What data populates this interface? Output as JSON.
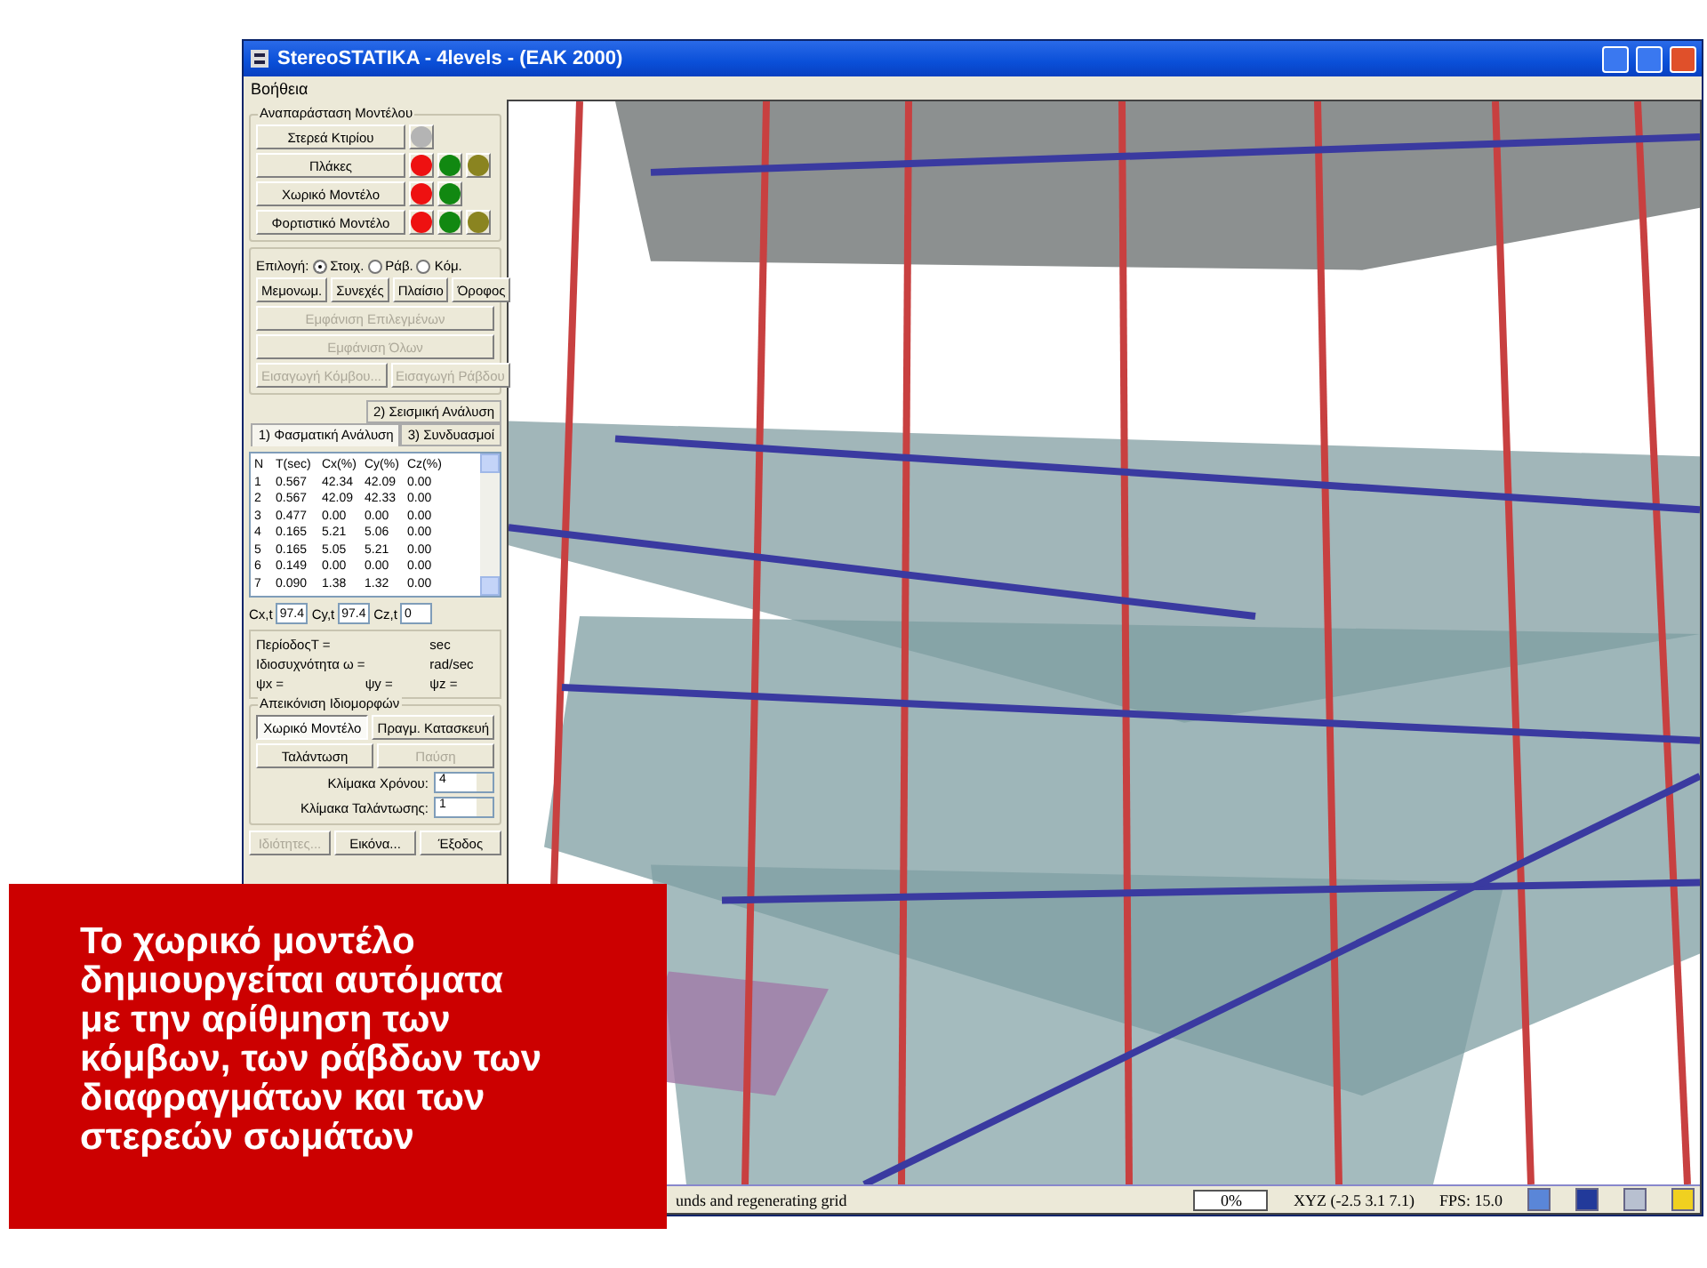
{
  "window": {
    "title": "StereoSTATIKA - 4levels - (EAK 2000)"
  },
  "menu": [
    "Βοήθεια"
  ],
  "model_group": {
    "title": "Αναπαράσταση Μοντέλου",
    "rows": [
      {
        "label": "Στερεά Κτιρίου",
        "lights": [
          {
            "color": "#b4b4b4"
          }
        ]
      },
      {
        "label": "Πλάκες",
        "lights": [
          {
            "color": "#ee1111"
          },
          {
            "color": "#118811"
          },
          {
            "color": "#8a8420"
          }
        ]
      },
      {
        "label": "Χωρικό Μοντέλο",
        "lights": [
          {
            "color": "#ee1111"
          },
          {
            "color": "#118811"
          }
        ]
      },
      {
        "label": "Φορτιστικό Μοντέλο",
        "lights": [
          {
            "color": "#ee1111"
          },
          {
            "color": "#118811"
          },
          {
            "color": "#8a8420"
          }
        ]
      }
    ]
  },
  "selection": {
    "label": "Επιλογή:",
    "radios": [
      {
        "label": "Στοιχ.",
        "selected": true
      },
      {
        "label": "Ράβ.",
        "selected": false
      },
      {
        "label": "Κόμ.",
        "selected": false
      }
    ],
    "buttons": [
      {
        "label": "Μεμονωμ.",
        "disabled": false
      },
      {
        "label": "Συνεχές",
        "disabled": false
      },
      {
        "label": "Πλαίσιο",
        "disabled": false
      },
      {
        "label": "Όροφος",
        "disabled": false
      }
    ],
    "wide_buttons": [
      {
        "label": "Εμφάνιση Επιλεγμένων",
        "disabled": true
      },
      {
        "label": "Εμφάνιση Όλων",
        "disabled": true
      }
    ],
    "insert_buttons": [
      {
        "label": "Εισαγωγή Κόμβου...",
        "disabled": true
      },
      {
        "label": "Εισαγωγή Ράβδου",
        "disabled": true
      }
    ]
  },
  "tabs": [
    {
      "label": "2) Σεισμική Ανάλυση",
      "selected": false
    },
    {
      "label": "1) Φασματική Ανάλυση",
      "selected": true
    },
    {
      "label": "3) Συνδυασμοί",
      "selected": false
    }
  ],
  "table": {
    "columns": [
      "N",
      "T(sec)",
      "Cx(%)",
      "Cy(%)",
      "Cz(%)"
    ],
    "rows": [
      [
        "1",
        "0.567",
        "42.34",
        "42.09",
        "0.00"
      ],
      [
        "2",
        "0.567",
        "42.09",
        "42.33",
        "0.00"
      ],
      [
        "3",
        "0.477",
        "0.00",
        "0.00",
        "0.00"
      ],
      [
        "4",
        "0.165",
        "5.21",
        "5.06",
        "0.00"
      ],
      [
        "5",
        "0.165",
        "5.05",
        "5.21",
        "0.00"
      ],
      [
        "6",
        "0.149",
        "0.00",
        "0.00",
        "0.00"
      ],
      [
        "7",
        "0.090",
        "1.38",
        "1.32",
        "0.00"
      ]
    ]
  },
  "totals": [
    {
      "label": "Cx,t",
      "value": "97.4"
    },
    {
      "label": "Cy,t",
      "value": "97.4"
    },
    {
      "label": "Cz,t",
      "value": "0"
    }
  ],
  "info": {
    "period": "ΠερίοδοςT =",
    "period_unit": "sec",
    "frequency": "Ιδιοσυχνότητα ω =",
    "frequency_unit": "rad/sec",
    "psi": [
      "ψx =",
      "ψy =",
      "ψz ="
    ]
  },
  "modes": {
    "title": "Απεικόνιση Ιδιομορφών",
    "buttons": [
      {
        "label": "Χωρικό Μοντέλο",
        "pressed": true,
        "disabled": false
      },
      {
        "label": "Πραγμ. Κατασκευή",
        "pressed": false,
        "disabled": false
      },
      {
        "label": "Ταλάντωση",
        "pressed": false,
        "disabled": false
      },
      {
        "label": "Παύση",
        "pressed": false,
        "disabled": true
      }
    ],
    "spinners": [
      {
        "label": "Κλίμακα Χρόνου:",
        "value": "4"
      },
      {
        "label": "Κλίμακα Ταλάντωσης:",
        "value": "1"
      }
    ]
  },
  "bottom_buttons": [
    {
      "label": "Ιδιότητες...",
      "disabled": true
    },
    {
      "label": "Εικόνα...",
      "disabled": false
    },
    {
      "label": "Έξοδος",
      "disabled": false
    }
  ],
  "status_bar": {
    "message": "unds and regenerating grid",
    "progress": "0%",
    "coords": "XYZ (-2.5  3.1  7.1)",
    "fps": "FPS: 15.0"
  },
  "caption": {
    "lines": [
      "Το χωρικό μοντέλο",
      "δημιουργείται αυτόματα",
      "με την αρίθμηση των",
      "κόμβων, των ράβδων των",
      "διαφραγμάτων και των",
      "στερεών σωμάτων"
    ]
  }
}
